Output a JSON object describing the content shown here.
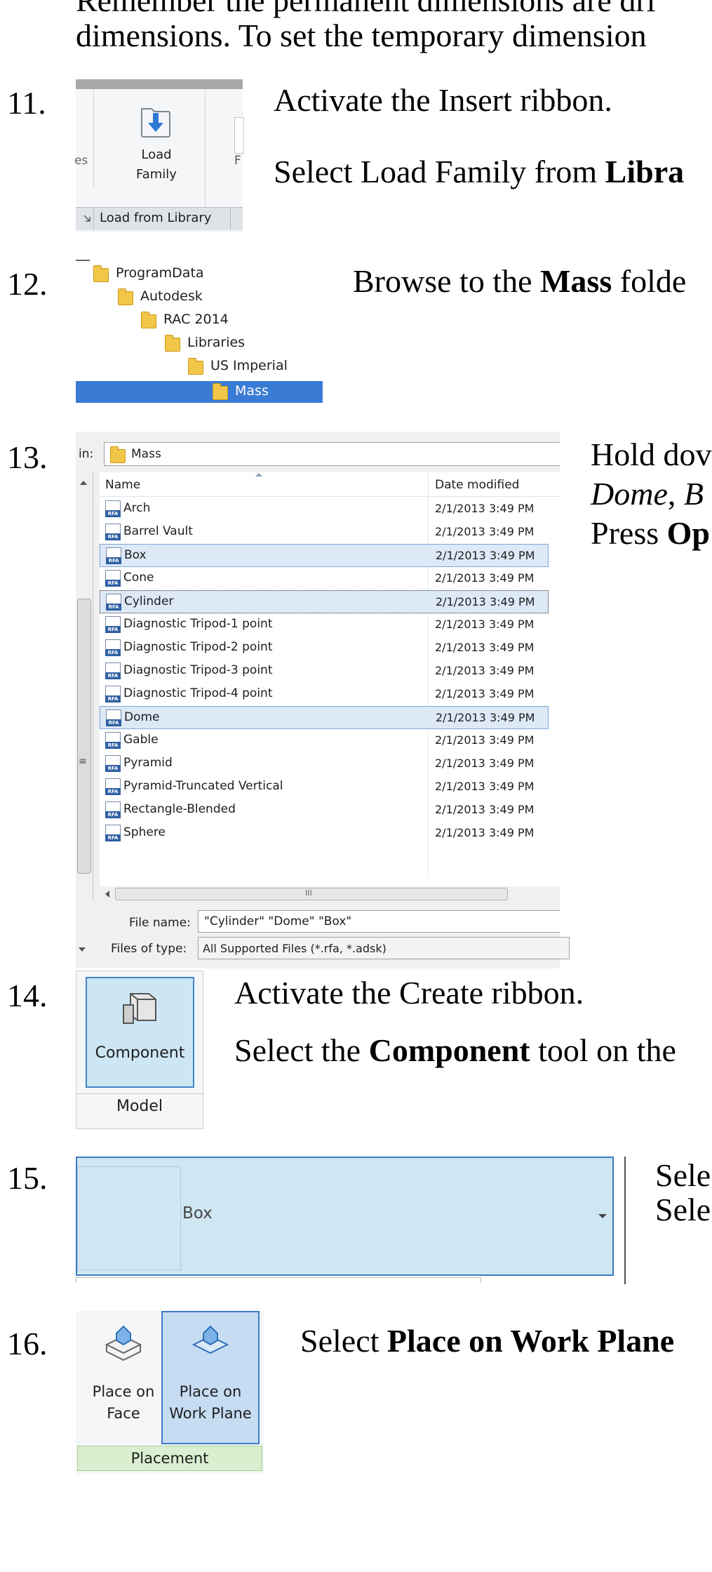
{
  "intro": {
    "line1": "Remember the permanent dimensions are dri",
    "line2": "dimensions.  To set the temporary dimension"
  },
  "step11": {
    "number": "11.",
    "ribbon": {
      "button_label_1": "Load",
      "button_label_2": "Family",
      "panel_label": "Load from Library",
      "edge_left": "es",
      "edge_right": "F"
    },
    "text1": "Activate the Insert ribbon.",
    "text2_prefix": "Select Load Family from ",
    "text2_bold": "Libra"
  },
  "step12": {
    "number": "12.",
    "tree": [
      "ProgramData",
      "Autodesk",
      "RAC 2014",
      "Libraries",
      "US Imperial",
      "Mass"
    ],
    "text_prefix": "Browse to the ",
    "text_bold": "Mass",
    "text_suffix": " folde"
  },
  "step13": {
    "number": "13.",
    "dialog": {
      "look_in_label": "in:",
      "look_in_value": "Mass",
      "col_name": "Name",
      "col_date": "Date modified",
      "files": [
        {
          "name": "Arch",
          "date": "2/1/2013 3:49 PM"
        },
        {
          "name": "Barrel Vault",
          "date": "2/1/2013 3:49 PM"
        },
        {
          "name": "Box",
          "date": "2/1/2013 3:49 PM"
        },
        {
          "name": "Cone",
          "date": "2/1/2013 3:49 PM"
        },
        {
          "name": "Cylinder",
          "date": "2/1/2013 3:49 PM"
        },
        {
          "name": "Diagnostic Tripod-1 point",
          "date": "2/1/2013 3:49 PM"
        },
        {
          "name": "Diagnostic Tripod-2 point",
          "date": "2/1/2013 3:49 PM"
        },
        {
          "name": "Diagnostic Tripod-3 point",
          "date": "2/1/2013 3:49 PM"
        },
        {
          "name": "Diagnostic Tripod-4 point",
          "date": "2/1/2013 3:49 PM"
        },
        {
          "name": "Dome",
          "date": "2/1/2013 3:49 PM"
        },
        {
          "name": "Gable",
          "date": "2/1/2013 3:49 PM"
        },
        {
          "name": "Pyramid",
          "date": "2/1/2013 3:49 PM"
        },
        {
          "name": "Pyramid-Truncated Vertical",
          "date": "2/1/2013 3:49 PM"
        },
        {
          "name": "Rectangle-Blended",
          "date": "2/1/2013 3:49 PM"
        },
        {
          "name": "Sphere",
          "date": "2/1/2013 3:49 PM"
        }
      ],
      "scroll_grip": "III",
      "file_name_label": "File name:",
      "file_name_value": "\"Cylinder\" \"Dome\" \"Box\"",
      "file_type_label": "Files of type:",
      "file_type_value": "All Supported Files  (*.rfa, *.adsk)"
    },
    "text1": "Hold dov",
    "text2_italic_1": "Dome",
    "text2_sep": ", ",
    "text2_italic_2": "B",
    "text3_prefix": "Press ",
    "text3_bold": "Op"
  },
  "step14": {
    "number": "14.",
    "button_label": "Component",
    "panel_label": "Model",
    "text1": "Activate the Create ribbon.",
    "text2_prefix": "Select the ",
    "text2_bold": "Component",
    "text2_suffix": " tool on the"
  },
  "step15": {
    "number": "15.",
    "dropdown_value": "Box",
    "text1": "Sele",
    "text2": "Sele"
  },
  "step16": {
    "number": "16.",
    "btn1_line1": "Place on",
    "btn1_line2": "Face",
    "btn2_line1": "Place on",
    "btn2_line2": "Work Plane",
    "panel_label": "Placement",
    "text_prefix": "Select ",
    "text_bold": "Place on Work Plane"
  }
}
